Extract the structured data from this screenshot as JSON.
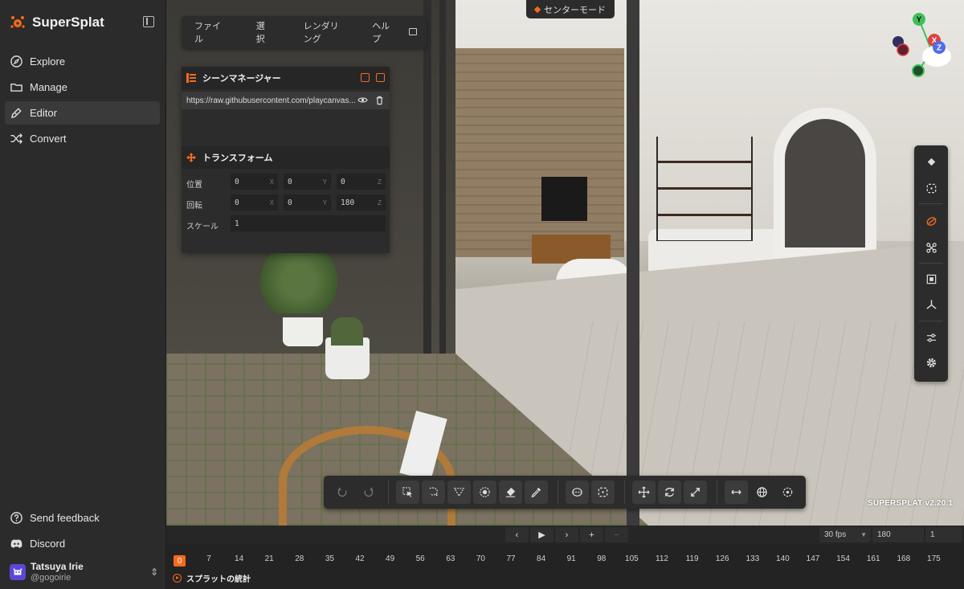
{
  "app": {
    "title": "SuperSplat",
    "version": "SUPERSPLAT v2.20.1",
    "accent_color": "#f26b1d"
  },
  "sidebar": {
    "items": [
      {
        "label": "Explore",
        "icon": "compass-icon"
      },
      {
        "label": "Manage",
        "icon": "folder-icon"
      },
      {
        "label": "Editor",
        "icon": "pen-icon",
        "active": true
      },
      {
        "label": "Convert",
        "icon": "shuffle-icon"
      }
    ],
    "footer": [
      {
        "label": "Send feedback",
        "icon": "question-icon"
      },
      {
        "label": "Discord",
        "icon": "discord-icon"
      }
    ],
    "user": {
      "name": "Tatsuya Irie",
      "handle": "@gogoirie"
    }
  },
  "menubar": {
    "items": [
      "ファイル",
      "選択",
      "レンダリング",
      "ヘルプ"
    ]
  },
  "mode_pill": {
    "label": "センターモード"
  },
  "scene_manager": {
    "title": "シーンマネージャー",
    "splat_url": "https://raw.githubusercontent.com/playcanvas...",
    "transform": {
      "title": "トランスフォーム",
      "position_label": "位置",
      "rotation_label": "回転",
      "scale_label": "スケール",
      "position": [
        "0",
        "0",
        "0"
      ],
      "rotation": [
        "0",
        "0",
        "180"
      ],
      "scale": "1",
      "axes": [
        "X",
        "Y",
        "Z"
      ]
    }
  },
  "gizmo": {
    "x": "X",
    "y": "Y",
    "z": "Z"
  },
  "timeline": {
    "current_frame": "0",
    "fps": "30 fps",
    "total_frames": "180",
    "speed": "1",
    "ticks": [
      "7",
      "14",
      "21",
      "28",
      "35",
      "42",
      "49",
      "56",
      "63",
      "70",
      "77",
      "84",
      "91",
      "98",
      "105",
      "112",
      "119",
      "126",
      "133",
      "140",
      "147",
      "154",
      "161",
      "168",
      "175"
    ],
    "stats_label": "スプラットの統計"
  }
}
